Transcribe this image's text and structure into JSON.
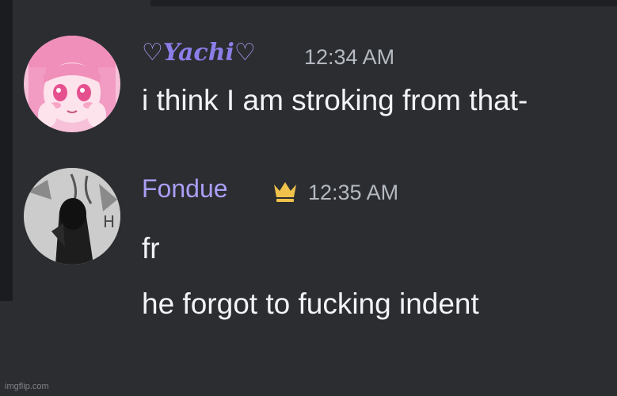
{
  "messages": [
    {
      "author": "Yachi",
      "heart_left": "♡",
      "heart_right": "♡",
      "timestamp": "12:34 AM",
      "lines": [
        "i think I am stroking from that-"
      ]
    },
    {
      "author": "Fondue",
      "timestamp": "12:35 AM",
      "badge_icon": "crown-icon",
      "lines": [
        "fr",
        "he forgot to fucking indent"
      ]
    }
  ],
  "watermark": "imgflip.com",
  "colors": {
    "background": "#2b2d31",
    "username_yachi": "#8b7ee8",
    "username_fondue": "#a99ff6",
    "timestamp": "#b5bac1",
    "message_text": "#f2f3f5",
    "crown": "#f0c24b"
  }
}
